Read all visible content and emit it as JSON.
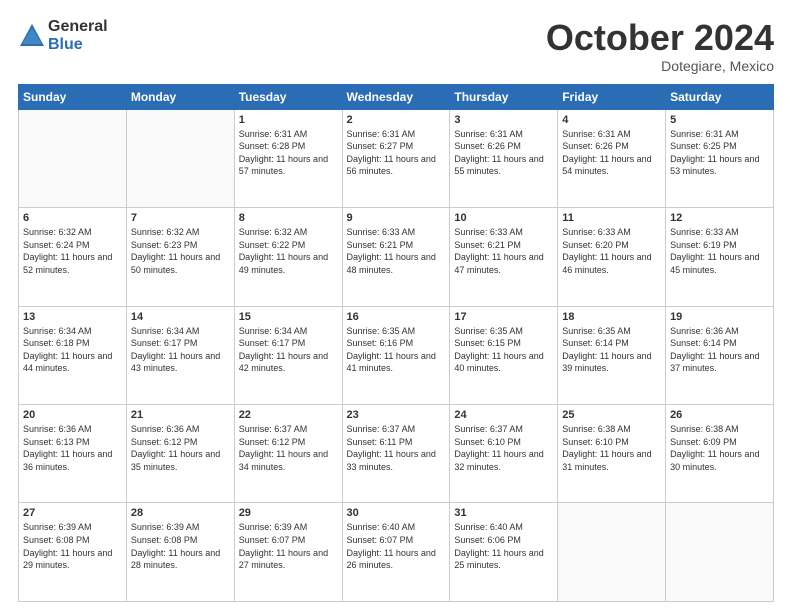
{
  "logo": {
    "general": "General",
    "blue": "Blue"
  },
  "header": {
    "month": "October 2024",
    "location": "Dotegiare, Mexico"
  },
  "days_of_week": [
    "Sunday",
    "Monday",
    "Tuesday",
    "Wednesday",
    "Thursday",
    "Friday",
    "Saturday"
  ],
  "weeks": [
    [
      {
        "day": "",
        "info": ""
      },
      {
        "day": "",
        "info": ""
      },
      {
        "day": "1",
        "info": "Sunrise: 6:31 AM\nSunset: 6:28 PM\nDaylight: 11 hours and 57 minutes."
      },
      {
        "day": "2",
        "info": "Sunrise: 6:31 AM\nSunset: 6:27 PM\nDaylight: 11 hours and 56 minutes."
      },
      {
        "day": "3",
        "info": "Sunrise: 6:31 AM\nSunset: 6:26 PM\nDaylight: 11 hours and 55 minutes."
      },
      {
        "day": "4",
        "info": "Sunrise: 6:31 AM\nSunset: 6:26 PM\nDaylight: 11 hours and 54 minutes."
      },
      {
        "day": "5",
        "info": "Sunrise: 6:31 AM\nSunset: 6:25 PM\nDaylight: 11 hours and 53 minutes."
      }
    ],
    [
      {
        "day": "6",
        "info": "Sunrise: 6:32 AM\nSunset: 6:24 PM\nDaylight: 11 hours and 52 minutes."
      },
      {
        "day": "7",
        "info": "Sunrise: 6:32 AM\nSunset: 6:23 PM\nDaylight: 11 hours and 50 minutes."
      },
      {
        "day": "8",
        "info": "Sunrise: 6:32 AM\nSunset: 6:22 PM\nDaylight: 11 hours and 49 minutes."
      },
      {
        "day": "9",
        "info": "Sunrise: 6:33 AM\nSunset: 6:21 PM\nDaylight: 11 hours and 48 minutes."
      },
      {
        "day": "10",
        "info": "Sunrise: 6:33 AM\nSunset: 6:21 PM\nDaylight: 11 hours and 47 minutes."
      },
      {
        "day": "11",
        "info": "Sunrise: 6:33 AM\nSunset: 6:20 PM\nDaylight: 11 hours and 46 minutes."
      },
      {
        "day": "12",
        "info": "Sunrise: 6:33 AM\nSunset: 6:19 PM\nDaylight: 11 hours and 45 minutes."
      }
    ],
    [
      {
        "day": "13",
        "info": "Sunrise: 6:34 AM\nSunset: 6:18 PM\nDaylight: 11 hours and 44 minutes."
      },
      {
        "day": "14",
        "info": "Sunrise: 6:34 AM\nSunset: 6:17 PM\nDaylight: 11 hours and 43 minutes."
      },
      {
        "day": "15",
        "info": "Sunrise: 6:34 AM\nSunset: 6:17 PM\nDaylight: 11 hours and 42 minutes."
      },
      {
        "day": "16",
        "info": "Sunrise: 6:35 AM\nSunset: 6:16 PM\nDaylight: 11 hours and 41 minutes."
      },
      {
        "day": "17",
        "info": "Sunrise: 6:35 AM\nSunset: 6:15 PM\nDaylight: 11 hours and 40 minutes."
      },
      {
        "day": "18",
        "info": "Sunrise: 6:35 AM\nSunset: 6:14 PM\nDaylight: 11 hours and 39 minutes."
      },
      {
        "day": "19",
        "info": "Sunrise: 6:36 AM\nSunset: 6:14 PM\nDaylight: 11 hours and 37 minutes."
      }
    ],
    [
      {
        "day": "20",
        "info": "Sunrise: 6:36 AM\nSunset: 6:13 PM\nDaylight: 11 hours and 36 minutes."
      },
      {
        "day": "21",
        "info": "Sunrise: 6:36 AM\nSunset: 6:12 PM\nDaylight: 11 hours and 35 minutes."
      },
      {
        "day": "22",
        "info": "Sunrise: 6:37 AM\nSunset: 6:12 PM\nDaylight: 11 hours and 34 minutes."
      },
      {
        "day": "23",
        "info": "Sunrise: 6:37 AM\nSunset: 6:11 PM\nDaylight: 11 hours and 33 minutes."
      },
      {
        "day": "24",
        "info": "Sunrise: 6:37 AM\nSunset: 6:10 PM\nDaylight: 11 hours and 32 minutes."
      },
      {
        "day": "25",
        "info": "Sunrise: 6:38 AM\nSunset: 6:10 PM\nDaylight: 11 hours and 31 minutes."
      },
      {
        "day": "26",
        "info": "Sunrise: 6:38 AM\nSunset: 6:09 PM\nDaylight: 11 hours and 30 minutes."
      }
    ],
    [
      {
        "day": "27",
        "info": "Sunrise: 6:39 AM\nSunset: 6:08 PM\nDaylight: 11 hours and 29 minutes."
      },
      {
        "day": "28",
        "info": "Sunrise: 6:39 AM\nSunset: 6:08 PM\nDaylight: 11 hours and 28 minutes."
      },
      {
        "day": "29",
        "info": "Sunrise: 6:39 AM\nSunset: 6:07 PM\nDaylight: 11 hours and 27 minutes."
      },
      {
        "day": "30",
        "info": "Sunrise: 6:40 AM\nSunset: 6:07 PM\nDaylight: 11 hours and 26 minutes."
      },
      {
        "day": "31",
        "info": "Sunrise: 6:40 AM\nSunset: 6:06 PM\nDaylight: 11 hours and 25 minutes."
      },
      {
        "day": "",
        "info": ""
      },
      {
        "day": "",
        "info": ""
      }
    ]
  ]
}
